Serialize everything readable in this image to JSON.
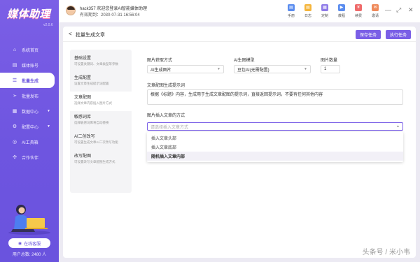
{
  "app": {
    "name": "媒体助理",
    "version": "v2.0.6"
  },
  "sidebar": {
    "items": [
      {
        "label": "系统首页",
        "icon": "home-icon",
        "glyph": "⌂"
      },
      {
        "label": "媒体账号",
        "icon": "account-icon",
        "glyph": "▤"
      },
      {
        "label": "批量生成",
        "icon": "generate-icon",
        "glyph": "☰"
      },
      {
        "label": "批量发布",
        "icon": "publish-icon",
        "glyph": "➢"
      },
      {
        "label": "数据中心",
        "icon": "data-icon",
        "glyph": "▦"
      },
      {
        "label": "配置中心",
        "icon": "settings-icon",
        "glyph": "⚙"
      },
      {
        "label": "AI工具箱",
        "icon": "ai-icon",
        "glyph": "◎"
      },
      {
        "label": "合作伙伴",
        "icon": "partner-icon",
        "glyph": "✣"
      }
    ],
    "service_button": "在线客服",
    "user_count": "用户总数: 2480 人"
  },
  "header": {
    "welcome": "hack357 欢迎您登录AI智能媒体助理",
    "expire": "有效期到：2030-07-31 16:56:04",
    "tools": [
      {
        "label": "手册",
        "color": "#5b8def"
      },
      {
        "label": "日志",
        "color": "#f5b53b"
      },
      {
        "label": "定制",
        "color": "#8f7be8"
      },
      {
        "label": "教程",
        "color": "#5b8def"
      },
      {
        "label": "续费",
        "color": "#ef6b6b"
      },
      {
        "label": "邀请",
        "color": "#ef8a5a"
      }
    ]
  },
  "page": {
    "back_label": "<",
    "title": "批量生成文章",
    "save_button": "保存任务",
    "run_button": "执行任务"
  },
  "steps": [
    {
      "title": "基础设置",
      "desc": "可设置关键词、文章类型等参数"
    },
    {
      "title": "生成配置",
      "desc": "设置文章生成提示词配置"
    },
    {
      "title": "文章配图",
      "desc": "选择文章内容插入图片方式"
    },
    {
      "title": "敏感词库",
      "desc": "选择敏感词库将自动替换"
    },
    {
      "title": "AI二创改写",
      "desc": "可设置生成文章AI二次改写功能"
    },
    {
      "title": "改写配图",
      "desc": "可设置改写文章配图生成方式"
    }
  ],
  "form": {
    "image_source_label": "图片获取方式",
    "image_source_value": "AI生成图片",
    "model_label": "AI生图模型",
    "model_value": "豆包AI(无需配置)",
    "count_label": "图片数量",
    "count_value": "1",
    "prompt_label": "文章配图生成提示词",
    "prompt_value": "根据《标题》内容，生成用于生成文章配图的提示词，直接返回提示词，不要有任何其他内容",
    "insert_label": "图片插入文章的方式",
    "insert_placeholder": "请选择插入文章方式",
    "insert_options": [
      "插入文章头部",
      "插入文章底部",
      "随机插入文章内部"
    ]
  },
  "watermark": "头条号 / 米小韦"
}
